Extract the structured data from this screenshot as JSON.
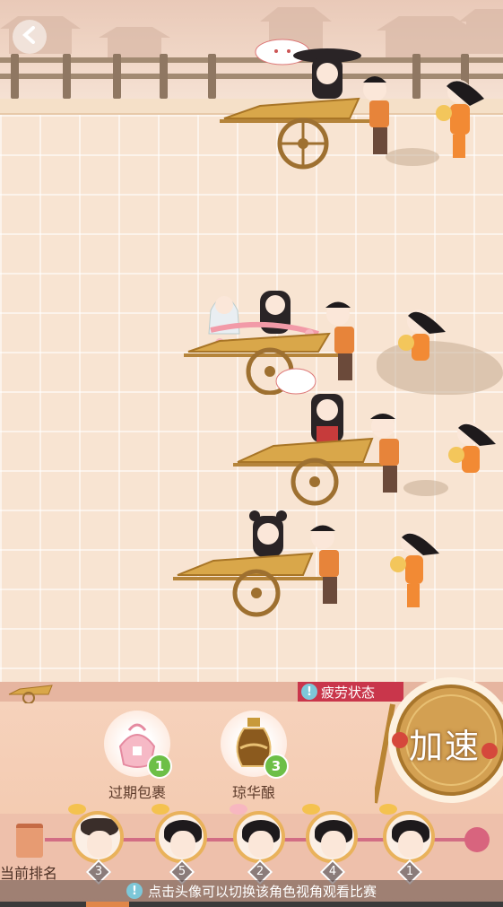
{
  "status": {
    "fatigue_label": "疲劳状态"
  },
  "items": [
    {
      "name": "过期包裹",
      "count": "1",
      "icon": "bundle-icon"
    },
    {
      "name": "琼华酿",
      "count": "3",
      "icon": "wine-jar-icon"
    }
  ],
  "speed_button": {
    "label": "加速"
  },
  "ranking": {
    "title": "当前排名",
    "racers": [
      {
        "rank": "3",
        "icon": "hat-racer-avatar"
      },
      {
        "rank": "5",
        "icon": "dark-hair-racer-avatar"
      },
      {
        "rank": "2",
        "icon": "flower-racer-avatar"
      },
      {
        "rank": "4",
        "icon": "white-crown-racer-avatar"
      },
      {
        "rank": "1",
        "icon": "bun-racer-avatar"
      }
    ]
  },
  "tip": {
    "text": "点击头像可以切换该角色视角观看比赛"
  },
  "colors": {
    "accent": "#e9b25b",
    "fatigue": "#c9364b",
    "count_badge": "#6dbf47",
    "rank_track": "#d26d84"
  }
}
